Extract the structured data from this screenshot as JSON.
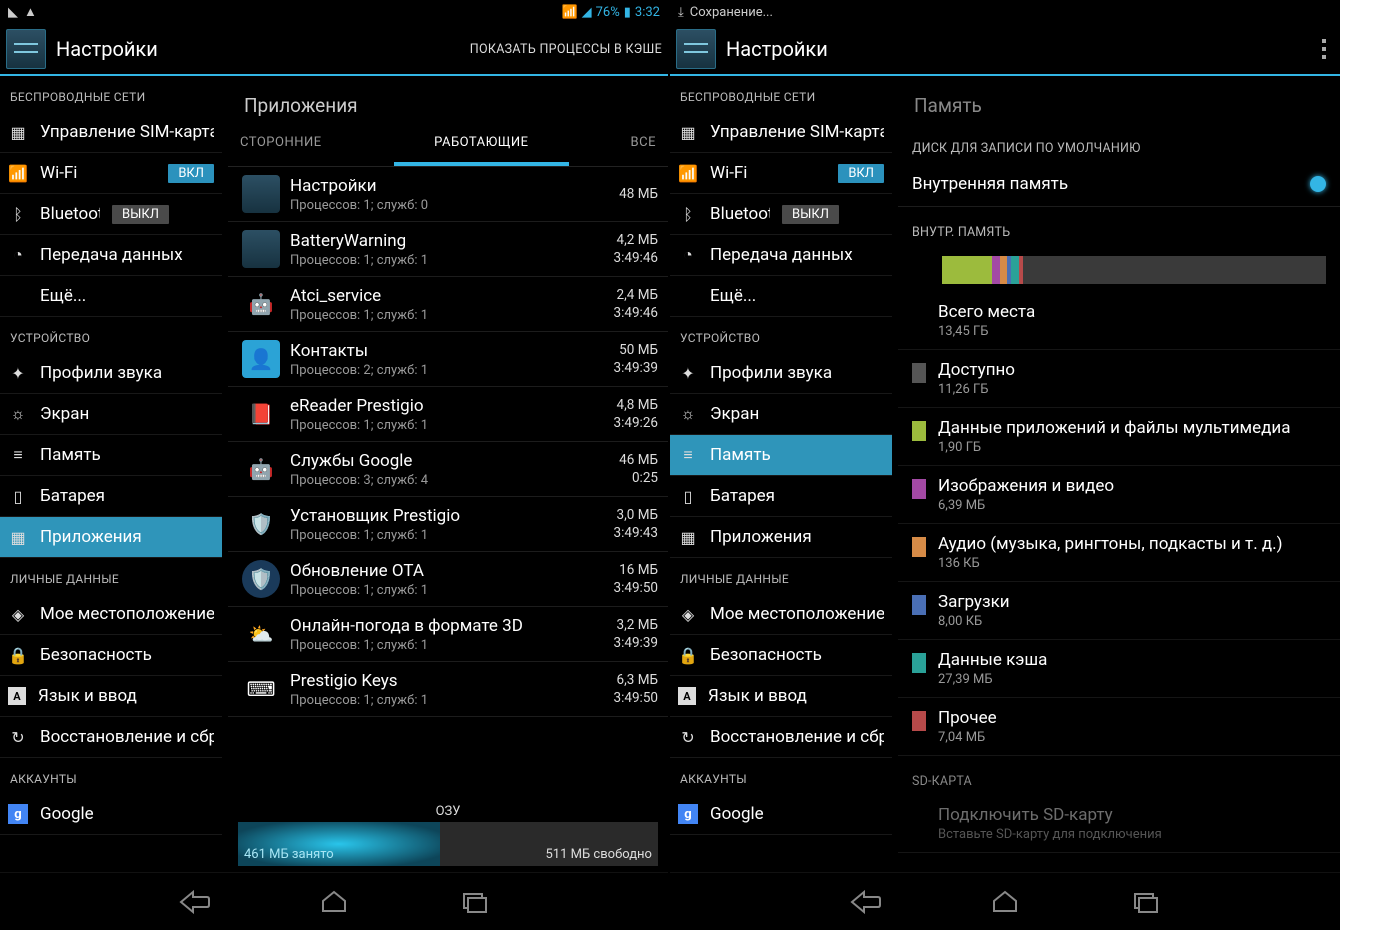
{
  "status": {
    "wifi_pct": "76%",
    "time": "3:32",
    "saving": "Сохранение..."
  },
  "actionbar": {
    "title": "Настройки",
    "secondary": "ПОКАЗАТЬ ПРОЦЕССЫ В КЭШЕ"
  },
  "sidebar": {
    "sections": {
      "wireless": "БЕСПРОВОДНЫЕ СЕТИ",
      "device": "УСТРОЙСТВО",
      "personal": "ЛИЧНЫЕ ДАННЫЕ",
      "accounts": "АККАУНТЫ"
    },
    "sim": "Управление SIM-картами",
    "wifi": "Wi-Fi",
    "wifi_toggle": "ВКЛ",
    "bt": "Bluetooth",
    "bt_toggle": "ВЫКЛ",
    "data": "Передача данных",
    "more": "Ещё...",
    "audio": "Профили звука",
    "display": "Экран",
    "memory": "Память",
    "battery": "Батарея",
    "apps": "Приложения",
    "location": "Мое местоположение",
    "security": "Безопасность",
    "language": "Язык и ввод",
    "backup": "Восстановление и сброс",
    "google": "Google"
  },
  "apps_page": {
    "title": "Приложения",
    "tabs": {
      "thirdparty": "СТОРОННИЕ",
      "running": "РАБОТАЮЩИЕ",
      "all": "ВСЕ"
    },
    "list": [
      {
        "name": "Настройки",
        "sub": "Процессов: 1; служб: 0",
        "v1": "48 МБ",
        "v2": ""
      },
      {
        "name": "BatteryWarning",
        "sub": "Процессов: 1; служб: 1",
        "v1": "4,2 МБ",
        "v2": "3:49:46"
      },
      {
        "name": "Atci_service",
        "sub": "Процессов: 1; служб: 1",
        "v1": "2,4 МБ",
        "v2": "3:49:46"
      },
      {
        "name": "Контакты",
        "sub": "Процессов: 2; служб: 1",
        "v1": "50 МБ",
        "v2": "3:49:39"
      },
      {
        "name": "eReader Prestigio",
        "sub": "Процессов: 1; служб: 1",
        "v1": "4,8 МБ",
        "v2": "3:49:26"
      },
      {
        "name": "Службы Google",
        "sub": "Процессов: 3; служб: 4",
        "v1": "46 МБ",
        "v2": "0:25"
      },
      {
        "name": "Установщик Prestigio",
        "sub": "Процессов: 1; служб: 1",
        "v1": "3,0 МБ",
        "v2": "3:49:43"
      },
      {
        "name": "Обновление OTA",
        "sub": "Процессов: 1; служб: 1",
        "v1": "16 МБ",
        "v2": "3:49:50"
      },
      {
        "name": "Онлайн-погода в формате 3D",
        "sub": "Процессов: 1; служб: 1",
        "v1": "3,2 МБ",
        "v2": "3:49:39"
      },
      {
        "name": "Prestigio Keys",
        "sub": "Процессов: 1; служб: 1",
        "v1": "6,3 МБ",
        "v2": "3:49:50"
      }
    ],
    "ram": {
      "label": "ОЗУ",
      "used": "461 МБ занято",
      "free": "511 МБ свободно"
    }
  },
  "memory_page": {
    "title": "Память",
    "default_disk_h": "ДИСК ДЛЯ ЗАПИСИ ПО УМОЛЧАНИЮ",
    "internal_label": "Внутренняя память",
    "internal_h": "ВНУТР. ПАМЯТЬ",
    "segments": [
      {
        "color": "#9cbb3d",
        "w": 13
      },
      {
        "color": "#a349a4",
        "w": 2
      },
      {
        "color": "#d68b47",
        "w": 2
      },
      {
        "color": "#4a6fb5",
        "w": 1
      },
      {
        "color": "#2aa198",
        "w": 2
      },
      {
        "color": "#b74a4a",
        "w": 1
      }
    ],
    "rows": [
      {
        "swatch": "",
        "title": "Всего места",
        "sub": "13,45 ГБ"
      },
      {
        "swatch": "#555555",
        "title": "Доступно",
        "sub": "11,26 ГБ"
      },
      {
        "swatch": "#9cbb3d",
        "title": "Данные приложений и файлы мультимедиа",
        "sub": "1,90 ГБ"
      },
      {
        "swatch": "#a349a4",
        "title": "Изображения и видео",
        "sub": "6,39 МБ"
      },
      {
        "swatch": "#d68b47",
        "title": "Аудио (музыка, рингтоны, подкасты и т. д.)",
        "sub": "136 КБ"
      },
      {
        "swatch": "#4a6fb5",
        "title": "Загрузки",
        "sub": "8,00 КБ"
      },
      {
        "swatch": "#2aa198",
        "title": "Данные кэша",
        "sub": "27,39 МБ"
      },
      {
        "swatch": "#b74a4a",
        "title": "Прочее",
        "sub": "7,04 МБ"
      }
    ],
    "sd_h": "SD-КАРТА",
    "sd_title": "Подключить SD-карту",
    "sd_sub": "Вставьте SD-карту для подключения"
  }
}
